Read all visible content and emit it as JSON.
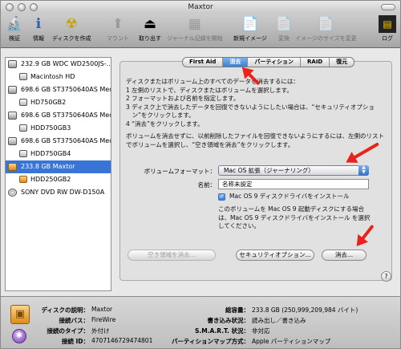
{
  "window": {
    "title": "Maxtor"
  },
  "toolbar": {
    "items": [
      {
        "label": "検証",
        "icon": "microscope-icon",
        "glyph": "🔬",
        "enabled": true
      },
      {
        "label": "情報",
        "icon": "info-icon",
        "glyph": "ℹ",
        "enabled": true
      },
      {
        "label": "ディスクを作成",
        "icon": "burn-icon",
        "glyph": "☢",
        "enabled": true
      },
      {
        "label": "マウント",
        "icon": "mount-icon",
        "glyph": "⬆",
        "enabled": false
      },
      {
        "label": "取り出す",
        "icon": "eject-icon",
        "glyph": "⏏",
        "enabled": true
      },
      {
        "label": "ジャーナル記録を開始",
        "icon": "journal-icon",
        "glyph": "▦",
        "enabled": false
      },
      {
        "label": "新規イメージ",
        "icon": "new-image-icon",
        "glyph": "📄",
        "enabled": true
      },
      {
        "label": "変換",
        "icon": "convert-icon",
        "glyph": "📄",
        "enabled": false
      },
      {
        "label": "イメージのサイズを変更",
        "icon": "resize-image-icon",
        "glyph": "📄",
        "enabled": false
      },
      {
        "label": "ログ",
        "icon": "log-icon",
        "glyph": "▤",
        "enabled": true
      }
    ]
  },
  "sidebar": {
    "items": [
      {
        "label": "232.9 GB WDC WD2500JS-...",
        "kind": "disk",
        "selected": false
      },
      {
        "label": "Macintosh HD",
        "kind": "volume",
        "selected": false
      },
      {
        "label": "698.6 GB ST3750640AS Med...",
        "kind": "disk",
        "selected": false
      },
      {
        "label": "HD750GB2",
        "kind": "volume",
        "selected": false
      },
      {
        "label": "698.6 GB ST3750640AS Med...",
        "kind": "disk",
        "selected": false
      },
      {
        "label": "HDD750GB3",
        "kind": "volume",
        "selected": false
      },
      {
        "label": "698.6 GB ST3750640AS Med...",
        "kind": "disk",
        "selected": false
      },
      {
        "label": "HDD750GB4",
        "kind": "volume",
        "selected": false
      },
      {
        "label": "233.8 GB Maxtor",
        "kind": "orange-disk",
        "selected": true
      },
      {
        "label": "HDD250GB2",
        "kind": "volume",
        "selected": false
      },
      {
        "label": "SONY DVD RW DW-D150A",
        "kind": "optical",
        "selected": false
      }
    ]
  },
  "tabs": [
    {
      "label": "First Aid",
      "active": false
    },
    {
      "label": "消去",
      "active": true
    },
    {
      "label": "パーティション",
      "active": false
    },
    {
      "label": "RAID",
      "active": false
    },
    {
      "label": "復元",
      "active": false
    }
  ],
  "erase": {
    "instructions": [
      "ディスクまたはボリューム上のすべてのデータを消去するには：",
      "1 左側のリストで、ディスクまたはボリュームを選択します。",
      "2 フォーマットおよび名前を指定します。",
      "3 ディスク上で消去したデータを回復できないようにしたい場合は、“セキュリティオプショ",
      "　ン”をクリックします。",
      "4 “消去”をクリックします。"
    ],
    "free_space_note": [
      "ボリュームを消去せずに、以前削除したファイルを回復できないようにするには、左側のリスト",
      "でボリュームを選択し、“空き領域を消去”をクリックします。"
    ],
    "format_label": "ボリュームフォーマット：",
    "format_value": "Mac OS 拡張（ジャーナリング）",
    "name_label": "名前：",
    "name_value": "名称未設定",
    "os9_checkbox_label": "Mac OS 9 ディスクドライバをインストール",
    "os9_checked": true,
    "os9_note": [
      "このボリュームを Mac OS 9 起動ディスクにする場合",
      "は、Mac OS 9 ディスクドライバをインストール を選択",
      "してください。"
    ],
    "erase_free_space_button": "空き領域を消去...",
    "security_options_button": "セキュリティオプション...",
    "erase_button": "消去...",
    "help_glyph": "?"
  },
  "info": {
    "left": [
      {
        "label": "ディスクの説明：",
        "value": "Maxtor"
      },
      {
        "label": "接続バス：",
        "value": "FireWire"
      },
      {
        "label": "接続のタイプ：",
        "value": "外付け"
      },
      {
        "label": "接続 ID：",
        "value": "4707146729474801"
      }
    ],
    "right": [
      {
        "label": "総容量：",
        "value": "233.8 GB (250,999,209,984 バイト)"
      },
      {
        "label": "書き込み状況：",
        "value": "読み出し／書き込み"
      },
      {
        "label": "S.M.A.R.T. 状況：",
        "value": "非対応"
      },
      {
        "label": "パーティションマップ方式：",
        "value": "Apple パーティションマップ"
      }
    ]
  },
  "colors": {
    "selection": "#3875d7",
    "annotation_arrow": "#e8231c",
    "drive_orange": "#e08a15"
  }
}
